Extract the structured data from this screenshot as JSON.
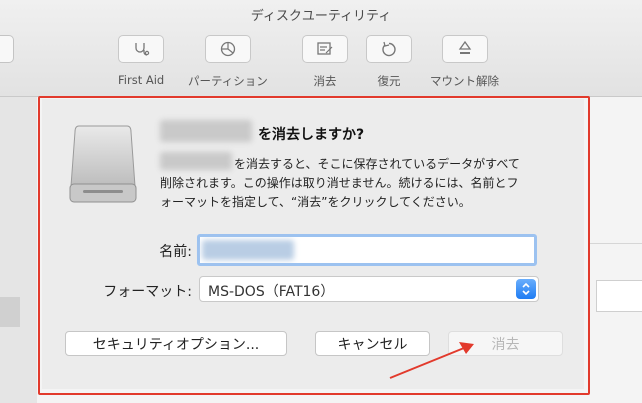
{
  "window": {
    "title": "ディスクユーティリティ"
  },
  "toolbar": {
    "items": [
      {
        "label": "First Aid",
        "icon": "stethoscope-icon"
      },
      {
        "label": "パーティション",
        "icon": "partition-icon"
      },
      {
        "label": "消去",
        "icon": "erase-icon"
      },
      {
        "label": "復元",
        "icon": "restore-icon"
      },
      {
        "label": "マウント解除",
        "icon": "eject-icon"
      }
    ]
  },
  "sheet": {
    "title_suffix": "を消去しますか?",
    "body_line1": "を消去すると、そこに保存されているデータがすべて",
    "body_line2": "削除されます。この操作は取り消せません。続けるには、名前とフ",
    "body_line3": "ォーマットを指定して、“消去”をクリックしてください。",
    "name_label": "名前:",
    "name_value": "",
    "format_label": "フォーマット:",
    "format_value": "MS-DOS（FAT16）",
    "security_button": "セキュリティオプション...",
    "cancel_button": "キャンセル",
    "erase_button": "消去"
  },
  "colors": {
    "highlight": "#e23a2c",
    "accent": "#1e7cf3"
  }
}
